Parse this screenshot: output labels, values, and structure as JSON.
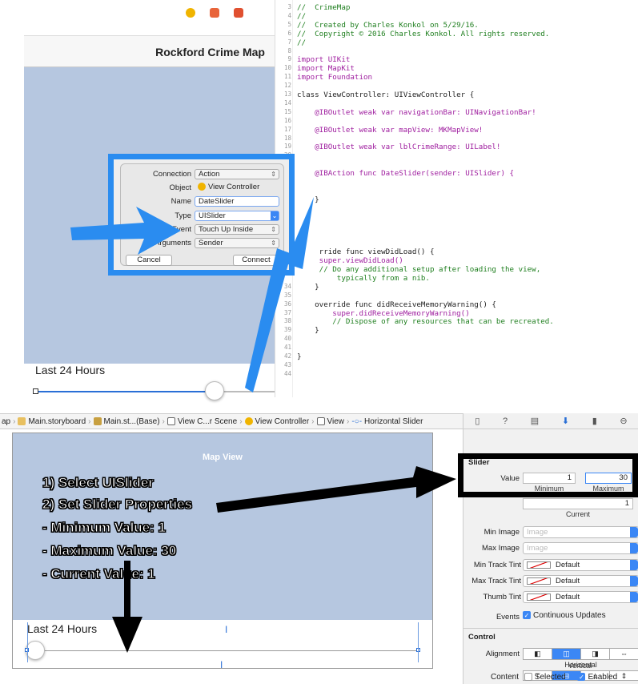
{
  "top_storyboard": {
    "nav_title": "Rockford Crime Map",
    "label": "Last 24 Hours"
  },
  "code": {
    "lines": [
      {
        "n": "3",
        "t": "//  CrimeMap",
        "c": "cm"
      },
      {
        "n": "4",
        "t": "//",
        "c": "cm"
      },
      {
        "n": "5",
        "t": "//  Created by Charles Konkol on 5/29/16.",
        "c": "cm"
      },
      {
        "n": "6",
        "t": "//  Copyright © 2016 Charles Konkol. All rights reserved.",
        "c": "cm"
      },
      {
        "n": "7",
        "t": "//",
        "c": "cm"
      },
      {
        "n": "8",
        "t": "",
        "c": ""
      },
      {
        "n": "9",
        "t": "import UIKit",
        "c": "kw"
      },
      {
        "n": "10",
        "t": "import MapKit",
        "c": "kw"
      },
      {
        "n": "11",
        "t": "import Foundation",
        "c": "kw"
      },
      {
        "n": "12",
        "t": "",
        "c": ""
      },
      {
        "n": "13",
        "t": "class ViewController: UIViewController {",
        "c": ""
      },
      {
        "n": "14",
        "t": "",
        "c": ""
      },
      {
        "n": "15",
        "t": "    @IBOutlet weak var navigationBar: UINavigationBar!",
        "c": "kw"
      },
      {
        "n": "16",
        "t": "",
        "c": ""
      },
      {
        "n": "17",
        "t": "    @IBOutlet weak var mapView: MKMapView!",
        "c": "kw"
      },
      {
        "n": "18",
        "t": "",
        "c": ""
      },
      {
        "n": "19",
        "t": "    @IBOutlet weak var lblCrimeRange: UILabel!",
        "c": "kw"
      },
      {
        "n": "20",
        "t": "",
        "c": ""
      },
      {
        "n": "21",
        "t": "",
        "c": ""
      },
      {
        "n": "22",
        "t": "    @IBAction func DateSlider(sender: UISlider) {",
        "c": "kw"
      },
      {
        "n": "23",
        "t": "",
        "c": ""
      },
      {
        "n": "24",
        "t": "",
        "c": ""
      },
      {
        "n": "25",
        "t": "    }",
        "c": ""
      },
      {
        "n": "26",
        "t": "",
        "c": ""
      },
      {
        "n": "27",
        "t": "",
        "c": ""
      },
      {
        "n": "28",
        "t": "",
        "c": ""
      },
      {
        "n": "29",
        "t": "",
        "c": ""
      },
      {
        "n": "30",
        "t": "",
        "c": ""
      },
      {
        "n": "31",
        "t": "     rride func viewDidLoad() {",
        "c": ""
      },
      {
        "n": "32",
        "t": "     super.viewDidLoad()",
        "c": "kw"
      },
      {
        "n": "33",
        "t": "     // Do any additional setup after loading the view,",
        "c": "cm"
      },
      {
        "n": "",
        "t": "         typically from a nib.",
        "c": "cm"
      },
      {
        "n": "34",
        "t": "    }",
        "c": ""
      },
      {
        "n": "35",
        "t": "",
        "c": ""
      },
      {
        "n": "36",
        "t": "    override func didReceiveMemoryWarning() {",
        "c": ""
      },
      {
        "n": "37",
        "t": "        super.didReceiveMemoryWarning()",
        "c": "kw"
      },
      {
        "n": "38",
        "t": "        // Dispose of any resources that can be recreated.",
        "c": "cm"
      },
      {
        "n": "39",
        "t": "    }",
        "c": ""
      },
      {
        "n": "40",
        "t": "",
        "c": ""
      },
      {
        "n": "41",
        "t": "",
        "c": ""
      },
      {
        "n": "42",
        "t": "}",
        "c": ""
      },
      {
        "n": "43",
        "t": "",
        "c": ""
      },
      {
        "n": "44",
        "t": "",
        "c": ""
      }
    ]
  },
  "popup": {
    "connection_label": "Connection",
    "connection_value": "Action",
    "object_label": "Object",
    "object_value": "View Controller",
    "name_label": "Name",
    "name_value": "DateSlider",
    "type_label": "Type",
    "type_value": "UISlider",
    "event_label": "Event",
    "event_value": "Touch Up Inside",
    "arguments_label": "Arguments",
    "arguments_value": "Sender",
    "cancel": "Cancel",
    "connect": "Connect"
  },
  "breadcrumb": {
    "items": [
      "ap",
      "Main.storyboard",
      "Main.st...(Base)",
      "View C...r Scene",
      "View Controller",
      "View",
      "Horizontal Slider"
    ]
  },
  "bottom_storyboard": {
    "map_label": "Map View",
    "label": "Last 24 Hours",
    "instructions": [
      "1) Select UISlider",
      "2) Set Slider Properties",
      "- Minimum Value: 1",
      "- Maximum Value: 30",
      "- Current Value: 1"
    ]
  },
  "inspector": {
    "section_slider": "Slider",
    "value_label": "Value",
    "min_value": "1",
    "max_value": "30",
    "min_caption": "Minimum",
    "max_caption": "Maximum",
    "current_value": "1",
    "current_caption": "Current",
    "min_image_label": "Min Image",
    "max_image_label": "Max Image",
    "image_placeholder": "Image",
    "min_track_label": "Min Track Tint",
    "max_track_label": "Max Track Tint",
    "thumb_tint_label": "Thumb Tint",
    "tint_value": "Default",
    "events_label": "Events",
    "continuous_label": "Continuous Updates",
    "section_control": "Control",
    "alignment_label": "Alignment",
    "horizontal_caption": "Horizontal",
    "vertical_caption": "Vertical",
    "content_label": "Content",
    "selected_label": "Selected",
    "enabled_label": "Enabled"
  },
  "colors": {
    "accent": "#2a8cf0",
    "map": "#b6c7e0",
    "black": "#000000"
  }
}
